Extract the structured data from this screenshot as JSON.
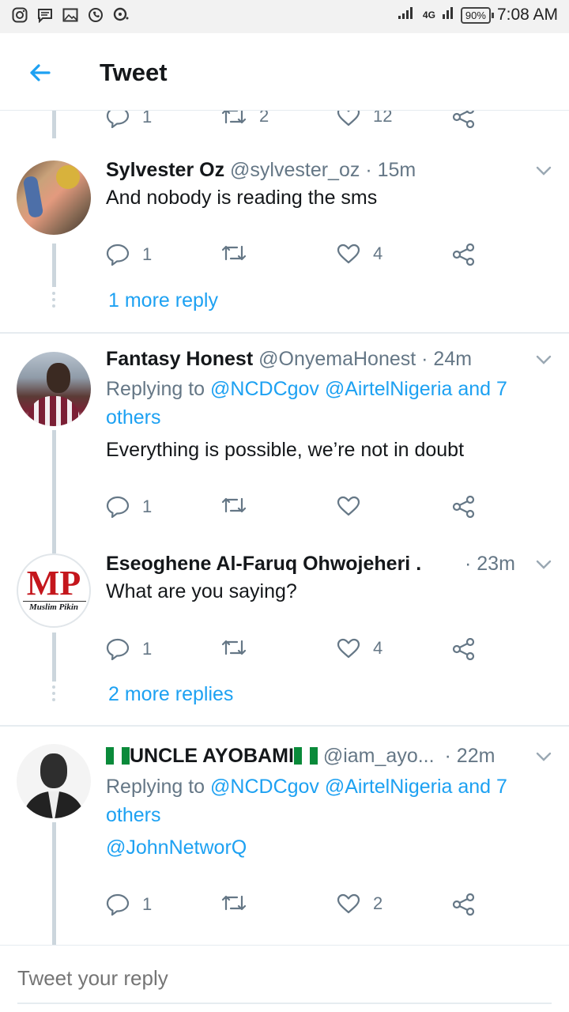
{
  "status_bar": {
    "network": "4G",
    "battery": "90%",
    "time": "7:08 AM"
  },
  "header": {
    "title": "Tweet"
  },
  "partial_tweet": {
    "replies": "1",
    "retweets": "2",
    "likes": "12"
  },
  "tweets": [
    {
      "name": "Sylvester Oz",
      "handle": "@sylvester_oz",
      "time": "· 15m",
      "text": "And nobody is reading the sms",
      "replies": "1",
      "retweets": "",
      "likes": "4",
      "more": "1 more reply"
    },
    {
      "name": "Fantasy Honest",
      "handle": "@OnyemaHonest",
      "time": "· 24m",
      "replying_prefix": "Replying to ",
      "replying_to": "@NCDCgov @AirtelNigeria and 7",
      "replying_to_2": "others",
      "text": "Everything is possible, we’re not in doubt",
      "replies": "1",
      "retweets": "",
      "likes": ""
    },
    {
      "name": "Eseoghene Al-Faruq Ohwojeheri ...",
      "handle": "",
      "time": "· 23m",
      "text": "What are you saying?",
      "avatar_logo": "MP",
      "avatar_caption": "Muslim Pikin",
      "replies": "1",
      "retweets": "",
      "likes": "4",
      "more": "2 more replies"
    },
    {
      "name": "UNCLE AYOBAMI",
      "handle": "@iam_ayo...",
      "time": "· 22m",
      "replying_prefix": "Replying to ",
      "replying_to": "@NCDCgov @AirtelNigeria and 7",
      "replying_to_2": "others",
      "text": "@JohnNetworQ",
      "replies": "1",
      "retweets": "",
      "likes": "2"
    }
  ],
  "reply_bar": {
    "placeholder": "Tweet your reply"
  },
  "colors": {
    "accent": "#1da1f2",
    "muted": "#657786",
    "line": "#ccd6dd"
  }
}
